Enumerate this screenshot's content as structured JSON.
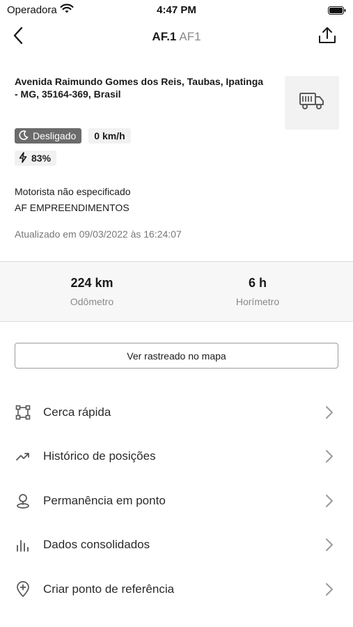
{
  "status_bar": {
    "carrier": "Operadora",
    "time": "4:47 PM"
  },
  "nav": {
    "title_code": "AF.1",
    "title_sub": "AF1"
  },
  "vehicle": {
    "address": "Avenida Raimundo Gomes dos Reis, Taubas, Ipatinga - MG, 35164-369, Brasil",
    "status": "Desligado",
    "speed": "0 km/h",
    "battery": "83%",
    "driver": "Motorista não especificado",
    "company": "AF EMPREENDIMENTOS",
    "updated": "Atualizado em 09/03/2022 às 16:24:07"
  },
  "stats": {
    "odometer_value": "224 km",
    "odometer_label": "Odômetro",
    "hourmeter_value": "6 h",
    "hourmeter_label": "Horímetro"
  },
  "map_button": "Ver rastreado no mapa",
  "menu": [
    {
      "label": "Cerca rápida",
      "icon": "fence-icon"
    },
    {
      "label": "Histórico de posições",
      "icon": "trend-icon"
    },
    {
      "label": "Permanência em ponto",
      "icon": "pin-stay-icon"
    },
    {
      "label": "Dados consolidados",
      "icon": "bar-chart-icon"
    },
    {
      "label": "Criar ponto de referência",
      "icon": "add-location-icon"
    }
  ],
  "colors": {
    "status_badge_bg": "#6b6b6b",
    "text_primary": "#1a1a1a",
    "text_muted": "#8a8a8a"
  }
}
